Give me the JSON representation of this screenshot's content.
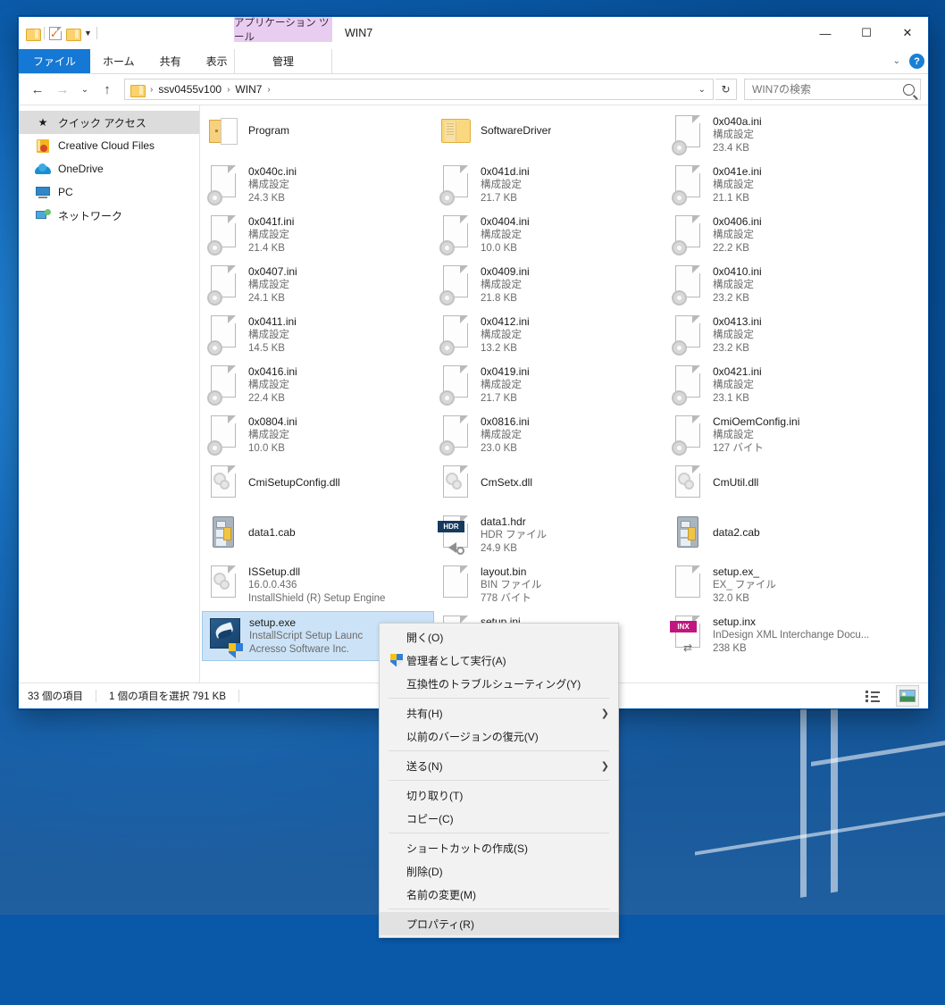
{
  "window": {
    "title": "WIN7",
    "app_tools_label": "アプリケーション ツール",
    "controls": {
      "minimize": "—",
      "maximize": "☐",
      "close": "✕"
    },
    "ribbon_collapse": "⌄",
    "help": "?"
  },
  "quick_access_toolbar": {
    "items": [
      {
        "name": "folder-icon",
        "label": ""
      },
      {
        "name": "properties-icon",
        "label": ""
      },
      {
        "name": "new-folder-icon",
        "label": ""
      },
      {
        "name": "customize-caret",
        "label": "▼"
      }
    ]
  },
  "ribbon": {
    "tabs": [
      {
        "label": "ファイル",
        "active": true
      },
      {
        "label": "ホーム",
        "active": false
      },
      {
        "label": "共有",
        "active": false
      },
      {
        "label": "表示",
        "active": false
      }
    ],
    "contextual_tab": {
      "label": "管理"
    }
  },
  "addressbar": {
    "back": "←",
    "forward": "→",
    "recent": "⌄",
    "up": "↑",
    "breadcrumbs": [
      "ssv0455v100",
      "WIN7"
    ],
    "separator": "›",
    "dropdown_caret": "⌄",
    "refresh": "↻"
  },
  "search": {
    "placeholder": "WIN7の検索",
    "value": "",
    "icon": "search-icon"
  },
  "sidebar": {
    "items": [
      {
        "label": "クイック アクセス",
        "icon": "star-icon",
        "selected": true
      },
      {
        "label": "Creative Cloud Files",
        "icon": "creative-cloud-icon",
        "selected": false
      },
      {
        "label": "OneDrive",
        "icon": "onedrive-cloud-icon",
        "selected": false
      },
      {
        "label": "PC",
        "icon": "computer-icon",
        "selected": false
      },
      {
        "label": "ネットワーク",
        "icon": "network-icon",
        "selected": false
      }
    ]
  },
  "files": [
    {
      "name": "Program",
      "type": "",
      "size": "",
      "icon": "open-folder-icon",
      "kind": "folder",
      "selected": false
    },
    {
      "name": "SoftwareDriver",
      "type": "",
      "size": "",
      "icon": "folder-icon",
      "kind": "folder",
      "selected": false
    },
    {
      "name": "0x040a.ini",
      "type": "構成設定",
      "size": "23.4 KB",
      "icon": "ini-file-icon",
      "kind": "ini",
      "selected": false
    },
    {
      "name": "0x040c.ini",
      "type": "構成設定",
      "size": "24.3 KB",
      "icon": "ini-file-icon",
      "kind": "ini",
      "selected": false
    },
    {
      "name": "0x041d.ini",
      "type": "構成設定",
      "size": "21.7 KB",
      "icon": "ini-file-icon",
      "kind": "ini",
      "selected": false
    },
    {
      "name": "0x041e.ini",
      "type": "構成設定",
      "size": "21.1 KB",
      "icon": "ini-file-icon",
      "kind": "ini",
      "selected": false
    },
    {
      "name": "0x041f.ini",
      "type": "構成設定",
      "size": "21.4 KB",
      "icon": "ini-file-icon",
      "kind": "ini",
      "selected": false
    },
    {
      "name": "0x0404.ini",
      "type": "構成設定",
      "size": "10.0 KB",
      "icon": "ini-file-icon",
      "kind": "ini",
      "selected": false
    },
    {
      "name": "0x0406.ini",
      "type": "構成設定",
      "size": "22.2 KB",
      "icon": "ini-file-icon",
      "kind": "ini",
      "selected": false
    },
    {
      "name": "0x0407.ini",
      "type": "構成設定",
      "size": "24.1 KB",
      "icon": "ini-file-icon",
      "kind": "ini",
      "selected": false
    },
    {
      "name": "0x0409.ini",
      "type": "構成設定",
      "size": "21.8 KB",
      "icon": "ini-file-icon",
      "kind": "ini",
      "selected": false
    },
    {
      "name": "0x0410.ini",
      "type": "構成設定",
      "size": "23.2 KB",
      "icon": "ini-file-icon",
      "kind": "ini",
      "selected": false
    },
    {
      "name": "0x0411.ini",
      "type": "構成設定",
      "size": "14.5 KB",
      "icon": "ini-file-icon",
      "kind": "ini",
      "selected": false
    },
    {
      "name": "0x0412.ini",
      "type": "構成設定",
      "size": "13.2 KB",
      "icon": "ini-file-icon",
      "kind": "ini",
      "selected": false
    },
    {
      "name": "0x0413.ini",
      "type": "構成設定",
      "size": "23.2 KB",
      "icon": "ini-file-icon",
      "kind": "ini",
      "selected": false
    },
    {
      "name": "0x0416.ini",
      "type": "構成設定",
      "size": "22.4 KB",
      "icon": "ini-file-icon",
      "kind": "ini",
      "selected": false
    },
    {
      "name": "0x0419.ini",
      "type": "構成設定",
      "size": "21.7 KB",
      "icon": "ini-file-icon",
      "kind": "ini",
      "selected": false
    },
    {
      "name": "0x0421.ini",
      "type": "構成設定",
      "size": "23.1 KB",
      "icon": "ini-file-icon",
      "kind": "ini",
      "selected": false
    },
    {
      "name": "0x0804.ini",
      "type": "構成設定",
      "size": "10.0 KB",
      "icon": "ini-file-icon",
      "kind": "ini",
      "selected": false
    },
    {
      "name": "0x0816.ini",
      "type": "構成設定",
      "size": "23.0 KB",
      "icon": "ini-file-icon",
      "kind": "ini",
      "selected": false
    },
    {
      "name": "CmiOemConfig.ini",
      "type": "構成設定",
      "size": "127 バイト",
      "icon": "ini-file-icon",
      "kind": "ini",
      "selected": false
    },
    {
      "name": "CmiSetupConfig.dll",
      "type": "",
      "size": "",
      "icon": "dll-file-icon",
      "kind": "dll",
      "selected": false
    },
    {
      "name": "CmSetx.dll",
      "type": "",
      "size": "",
      "icon": "dll-file-icon",
      "kind": "dll",
      "selected": false
    },
    {
      "name": "CmUtil.dll",
      "type": "",
      "size": "",
      "icon": "dll-file-icon",
      "kind": "dll",
      "selected": false
    },
    {
      "name": "data1.cab",
      "type": "",
      "size": "",
      "icon": "cabinet-file-icon",
      "kind": "cab",
      "selected": false
    },
    {
      "name": "data1.hdr",
      "type": "HDR ファイル",
      "size": "24.9 KB",
      "icon": "hdr-file-icon",
      "kind": "hdr",
      "selected": false
    },
    {
      "name": "data2.cab",
      "type": "",
      "size": "",
      "icon": "cabinet-file-icon",
      "kind": "cab",
      "selected": false
    },
    {
      "name": "ISSetup.dll",
      "type": "16.0.0.436",
      "size": "InstallShield (R) Setup Engine",
      "icon": "dll-file-icon",
      "kind": "dll3",
      "selected": false
    },
    {
      "name": "layout.bin",
      "type": "BIN ファイル",
      "size": "778 バイト",
      "icon": "bin-file-icon",
      "kind": "plain",
      "selected": false
    },
    {
      "name": "setup.ex_",
      "type": "EX_ ファイル",
      "size": "32.0 KB",
      "icon": "generic-file-icon",
      "kind": "plain",
      "selected": false
    },
    {
      "name": "setup.exe",
      "type": "InstallScript Setup Launc",
      "size": "Acresso Software Inc.",
      "icon": "setup-exe-icon",
      "kind": "exe",
      "selected": true
    },
    {
      "name": "setup.ini",
      "type": "",
      "size": "",
      "icon": "generic-file-icon",
      "kind": "plain",
      "selected": false
    },
    {
      "name": "setup.inx",
      "type": "InDesign XML Interchange Docu...",
      "size": "238 KB",
      "icon": "inx-file-icon",
      "kind": "inx",
      "selected": false
    }
  ],
  "context_menu": {
    "items": [
      {
        "label": "開く(O)",
        "icon": "",
        "submenu": false,
        "highlighted": false,
        "separator_after": false
      },
      {
        "label": "管理者として実行(A)",
        "icon": "shield-icon",
        "submenu": false,
        "highlighted": false,
        "separator_after": false
      },
      {
        "label": "互換性のトラブルシューティング(Y)",
        "icon": "",
        "submenu": false,
        "highlighted": false,
        "separator_after": true
      },
      {
        "label": "共有(H)",
        "icon": "",
        "submenu": true,
        "highlighted": false,
        "separator_after": false
      },
      {
        "label": "以前のバージョンの復元(V)",
        "icon": "",
        "submenu": false,
        "highlighted": false,
        "separator_after": true
      },
      {
        "label": "送る(N)",
        "icon": "",
        "submenu": true,
        "highlighted": false,
        "separator_after": true
      },
      {
        "label": "切り取り(T)",
        "icon": "",
        "submenu": false,
        "highlighted": false,
        "separator_after": false
      },
      {
        "label": "コピー(C)",
        "icon": "",
        "submenu": false,
        "highlighted": false,
        "separator_after": true
      },
      {
        "label": "ショートカットの作成(S)",
        "icon": "",
        "submenu": false,
        "highlighted": false,
        "separator_after": false
      },
      {
        "label": "削除(D)",
        "icon": "",
        "submenu": false,
        "highlighted": false,
        "separator_after": false
      },
      {
        "label": "名前の変更(M)",
        "icon": "",
        "submenu": false,
        "highlighted": false,
        "separator_after": true
      },
      {
        "label": "プロパティ(R)",
        "icon": "",
        "submenu": false,
        "highlighted": true,
        "separator_after": false
      }
    ],
    "submenu_arrow": "❯"
  },
  "statusbar": {
    "item_count": "33 個の項目",
    "selection": "1 個の項目を選択  791 KB",
    "views": [
      {
        "name": "details-view-button",
        "active": false
      },
      {
        "name": "large-icons-view-button",
        "active": true
      }
    ]
  },
  "colors": {
    "accent": "#1478d4",
    "selection": "#cce3f7",
    "contextual_tab": "#e9cdf0",
    "desktop": "#0a58a8"
  }
}
